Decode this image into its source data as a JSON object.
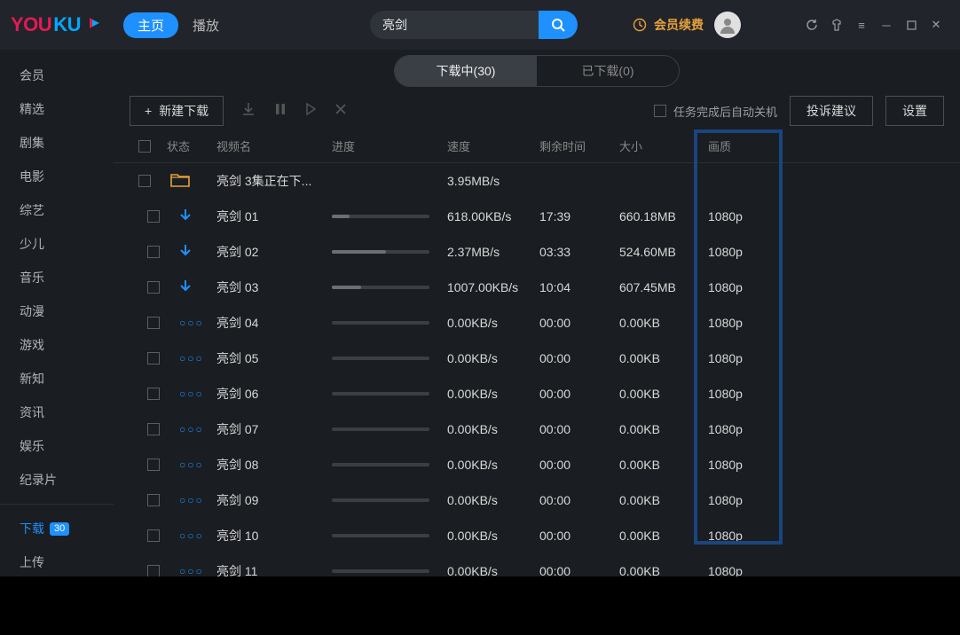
{
  "header": {
    "logo_you": "YOU",
    "logo_ku": "KU",
    "nav_home": "主页",
    "nav_play": "播放",
    "search_value": "亮剑",
    "vip_renew": "会员续费"
  },
  "sidebar": {
    "items": [
      {
        "label": "会员"
      },
      {
        "label": "精选"
      },
      {
        "label": "剧集"
      },
      {
        "label": "电影"
      },
      {
        "label": "综艺"
      },
      {
        "label": "少儿"
      },
      {
        "label": "音乐"
      },
      {
        "label": "动漫"
      },
      {
        "label": "游戏"
      },
      {
        "label": "新知"
      },
      {
        "label": "资讯"
      },
      {
        "label": "娱乐"
      },
      {
        "label": "纪录片"
      }
    ],
    "download": {
      "label": "下载",
      "badge": "30"
    },
    "upload": {
      "label": "上传"
    }
  },
  "tabs": {
    "downloading": "下载中(30)",
    "downloaded": "已下载(0)"
  },
  "toolbar": {
    "new_label": "新建下载",
    "auto_shutdown": "任务完成后自动关机",
    "feedback": "投诉建议",
    "settings": "设置"
  },
  "columns": {
    "status": "状态",
    "name": "视频名",
    "progress": "进度",
    "speed": "速度",
    "remaining": "剩余时间",
    "size": "大小",
    "quality": "画质"
  },
  "folder_row": {
    "name": "亮剑   3集正在下...",
    "speed": "3.95MB/s"
  },
  "rows": [
    {
      "status": "downloading",
      "name": "亮剑 01",
      "progress": 18,
      "speed": "618.00KB/s",
      "remaining": "17:39",
      "size": "660.18MB",
      "quality": "1080p"
    },
    {
      "status": "downloading",
      "name": "亮剑 02",
      "progress": 55,
      "speed": "2.37MB/s",
      "remaining": "03:33",
      "size": "524.60MB",
      "quality": "1080p"
    },
    {
      "status": "downloading",
      "name": "亮剑 03",
      "progress": 30,
      "speed": "1007.00KB/s",
      "remaining": "10:04",
      "size": "607.45MB",
      "quality": "1080p"
    },
    {
      "status": "waiting",
      "name": "亮剑 04",
      "progress": 0,
      "speed": "0.00KB/s",
      "remaining": "00:00",
      "size": "0.00KB",
      "quality": "1080p"
    },
    {
      "status": "waiting",
      "name": "亮剑 05",
      "progress": 0,
      "speed": "0.00KB/s",
      "remaining": "00:00",
      "size": "0.00KB",
      "quality": "1080p"
    },
    {
      "status": "waiting",
      "name": "亮剑 06",
      "progress": 0,
      "speed": "0.00KB/s",
      "remaining": "00:00",
      "size": "0.00KB",
      "quality": "1080p"
    },
    {
      "status": "waiting",
      "name": "亮剑 07",
      "progress": 0,
      "speed": "0.00KB/s",
      "remaining": "00:00",
      "size": "0.00KB",
      "quality": "1080p"
    },
    {
      "status": "waiting",
      "name": "亮剑 08",
      "progress": 0,
      "speed": "0.00KB/s",
      "remaining": "00:00",
      "size": "0.00KB",
      "quality": "1080p"
    },
    {
      "status": "waiting",
      "name": "亮剑 09",
      "progress": 0,
      "speed": "0.00KB/s",
      "remaining": "00:00",
      "size": "0.00KB",
      "quality": "1080p"
    },
    {
      "status": "waiting",
      "name": "亮剑 10",
      "progress": 0,
      "speed": "0.00KB/s",
      "remaining": "00:00",
      "size": "0.00KB",
      "quality": "1080p"
    },
    {
      "status": "waiting",
      "name": "亮剑 11",
      "progress": 0,
      "speed": "0.00KB/s",
      "remaining": "00:00",
      "size": "0.00KB",
      "quality": "1080p"
    }
  ]
}
